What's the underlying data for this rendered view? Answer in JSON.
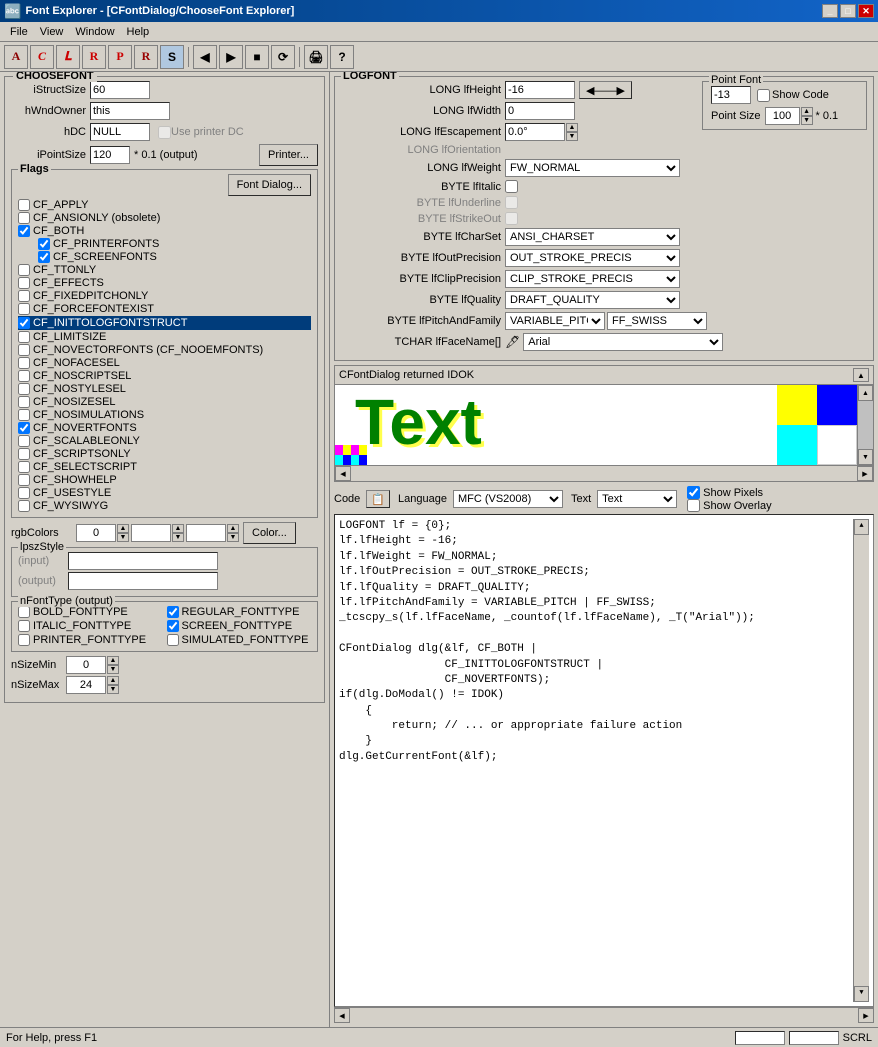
{
  "window": {
    "title": "Font Explorer - [CFontDialog/ChooseFont Explorer]",
    "icon": "🔤"
  },
  "menu": {
    "items": [
      "File",
      "View",
      "Window",
      "Help"
    ]
  },
  "choosefont": {
    "title": "CHOOSEFONT",
    "fields": {
      "iStructSize": {
        "label": "iStructSize",
        "value": "60"
      },
      "hWndOwner": {
        "label": "hWndOwner",
        "value": "this"
      },
      "hDC": {
        "label": "hDC",
        "value": "NULL"
      },
      "iPointSize": {
        "label": "iPointSize",
        "value": "120",
        "suffix": "* 0.1 (output)"
      }
    },
    "printer_dc_label": "Use printer DC",
    "printer_btn": "Printer...",
    "font_dialog_btn": "Font Dialog..."
  },
  "flags": {
    "title": "Flags",
    "items": [
      {
        "label": "CF_APPLY",
        "checked": false,
        "indent": false
      },
      {
        "label": "CF_ANSIONLY (obsolete)",
        "checked": false,
        "indent": false
      },
      {
        "label": "CF_BOTH",
        "checked": true,
        "indent": false
      },
      {
        "label": "CF_PRINTERFONTS",
        "checked": true,
        "indent": true
      },
      {
        "label": "CF_SCREENFONTS",
        "checked": true,
        "indent": true
      },
      {
        "label": "CF_TTONLY",
        "checked": false,
        "indent": false
      },
      {
        "label": "CF_EFFECTS",
        "checked": false,
        "indent": false
      },
      {
        "label": "CF_FIXEDPITCHONLY",
        "checked": false,
        "indent": false
      },
      {
        "label": "CF_FORCEFONTEXIST",
        "checked": false,
        "indent": false
      },
      {
        "label": "CF_INITTOLOGFONTSTRUCT",
        "checked": true,
        "indent": false,
        "highlighted": true
      },
      {
        "label": "CF_LIMITSIZE",
        "checked": false,
        "indent": false
      },
      {
        "label": "CF_NOVECTORFONTS (CF_NOOEMFONTS)",
        "checked": false,
        "indent": false
      },
      {
        "label": "CF_NOFACESEL",
        "checked": false,
        "indent": false
      },
      {
        "label": "CF_NOSCRIPTSEL",
        "checked": false,
        "indent": false
      },
      {
        "label": "CF_NOSTYLESEL",
        "checked": false,
        "indent": false
      },
      {
        "label": "CF_NOSIZESEL",
        "checked": false,
        "indent": false
      },
      {
        "label": "CF_NOSIMULATIONS",
        "checked": false,
        "indent": false
      },
      {
        "label": "CF_NOVERTFONTS",
        "checked": true,
        "indent": false
      },
      {
        "label": "CF_SCALABLEONLY",
        "checked": false,
        "indent": false
      },
      {
        "label": "CF_SCRIPTSONLY",
        "checked": false,
        "indent": false
      },
      {
        "label": "CF_SELECTSCRIPT",
        "checked": false,
        "indent": false
      },
      {
        "label": "CF_SHOWHELP",
        "checked": false,
        "indent": false
      },
      {
        "label": "CF_USESTYLE",
        "checked": false,
        "indent": false
      },
      {
        "label": "CF_WYSIWYG",
        "checked": false,
        "indent": false
      }
    ]
  },
  "rgb_colors": {
    "label": "rgbColors",
    "value1": "0",
    "value2": "",
    "value3": "",
    "btn": "Color..."
  },
  "lpsz_style": {
    "title": "lpszStyle",
    "input_label": "(input)",
    "output_label": "(output)"
  },
  "nfont_type": {
    "title": "nFontType (output)",
    "items": [
      {
        "label": "BOLD_FONTTYPE",
        "checked": false
      },
      {
        "label": "REGULAR_FONTTYPE",
        "checked": true
      },
      {
        "label": "ITALIC_FONTTYPE",
        "checked": false
      },
      {
        "label": "SCREEN_FONTTYPE",
        "checked": true
      },
      {
        "label": "PRINTER_FONTTYPE",
        "checked": false
      },
      {
        "label": "SIMULATED_FONTTYPE",
        "checked": false
      }
    ]
  },
  "nsize": {
    "min_label": "nSizeMin",
    "min_value": "0",
    "max_label": "nSizeMax",
    "max_value": "24"
  },
  "logfont": {
    "title": "LOGFONT",
    "fields": {
      "lfHeight": {
        "label": "LONG lfHeight",
        "value": "-16"
      },
      "lfWidth": {
        "label": "LONG lfWidth",
        "value": "0"
      },
      "lfEscapement": {
        "label": "LONG lfEscapement",
        "value": "0.0°"
      },
      "lfOrientation": {
        "label": "LONG lfOrientation",
        "disabled": true
      },
      "lfWeight": {
        "label": "LONG lfWeight",
        "value": "FW_NORMAL"
      },
      "lfItalic": {
        "label": "BYTE lfItalic",
        "checked": false
      },
      "lfUnderline": {
        "label": "BYTE lfUnderline",
        "disabled": true
      },
      "lfStrikeOut": {
        "label": "BYTE lfStrikeOut",
        "disabled": true
      },
      "lfCharSet": {
        "label": "BYTE lfCharSet",
        "value": "ANSI_CHARSET"
      },
      "lfOutPrecision": {
        "label": "BYTE lfOutPrecision",
        "value": "OUT_STROKE_PRECIS"
      },
      "lfClipPrecision": {
        "label": "BYTE lfClipPrecision",
        "value": "CLIP_STROKE_PRECIS"
      },
      "lfQuality": {
        "label": "BYTE lfQuality",
        "value": "DRAFT_QUALITY"
      },
      "lfPitchAndFamily": {
        "label": "BYTE lfPitchAndFamily",
        "value1": "VARIABLE_PITCH",
        "value2": "FF_SWISS"
      },
      "lfFaceName": {
        "label": "TCHAR lfFaceName[]",
        "value": "Arial"
      }
    },
    "point_font": {
      "title": "Point Font",
      "value": "-13",
      "show_code": "Show Code",
      "point_size_label": "Point Size",
      "point_size": "100",
      "point_size_suffix": "* 0.1"
    }
  },
  "preview": {
    "title": "CFontDialog returned IDOK",
    "text": "Text"
  },
  "code_toolbar": {
    "code_label": "Code",
    "language_label": "Language",
    "language_value": "MFC (VS2008)",
    "text_label": "Text",
    "show_pixels": "Show Pixels",
    "show_overlay": "Show Overlay",
    "show_pixels_checked": true,
    "show_overlay_checked": false
  },
  "code": {
    "content": "LOGFONT lf = {0};\nlf.lfHeight = -16;\nlf.lfWeight = FW_NORMAL;\nlf.lfOutPrecision = OUT_STROKE_PRECIS;\nlf.lfQuality = DRAFT_QUALITY;\nlf.lfPitchAndFamily = VARIABLE_PITCH | FF_SWISS;\n_tcscpy_s(lf.lfFaceName, _countof(lf.lfFaceName), _T(\"Arial\"));\n\nCFontDialog dlg(&lf, CF_BOTH |\n                CF_INITTOLOGFONTSTRUCT |\n                CF_NOVERTFONTS);\nif(dlg.DoModal() != IDOK)\n    {\n        return; // ... or appropriate failure action\n    }\ndlg.GetCurrentFont(&lf);"
  },
  "status_bar": {
    "help_text": "For Help, press F1",
    "scrl": "SCRL"
  },
  "toolbar_buttons": [
    "A",
    "C",
    "L",
    "R",
    "P",
    "R",
    "S",
    "▶",
    "■",
    "◆",
    "?"
  ]
}
